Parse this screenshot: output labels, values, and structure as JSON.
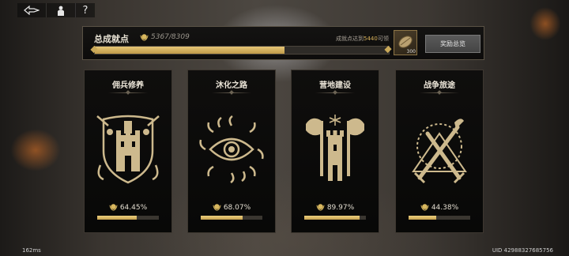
{
  "toolbar": {
    "items": [
      {
        "icon": "back-diamond-icon"
      },
      {
        "icon": "character-icon"
      },
      {
        "icon": "help-icon",
        "label": "?"
      }
    ]
  },
  "total": {
    "title": "总成就点",
    "count": "5367/8309",
    "progress": 0.646,
    "hint_prefix": "成就点达到",
    "hint_value": "5440",
    "hint_suffix": "可领",
    "reward_count": "300",
    "reward_button": "奖励总览"
  },
  "cards": [
    {
      "title": "佣兵修养",
      "percent": "64.45%",
      "progress": 0.6445,
      "emblem": "castle-shield-icon"
    },
    {
      "title": "沐化之路",
      "percent": "68.07%",
      "progress": 0.6807,
      "emblem": "eye-sun-icon"
    },
    {
      "title": "营地建设",
      "percent": "89.97%",
      "progress": 0.8997,
      "emblem": "tower-axes-icon"
    },
    {
      "title": "战争旅途",
      "percent": "44.38%",
      "progress": 0.4438,
      "emblem": "crossed-swords-icon"
    }
  ],
  "status": {
    "latency": "162ms",
    "uid": "UID 42988327685756"
  },
  "colors": {
    "gold": "#c9a858",
    "panel": "#0d0c0b",
    "border": "#5a5245"
  }
}
